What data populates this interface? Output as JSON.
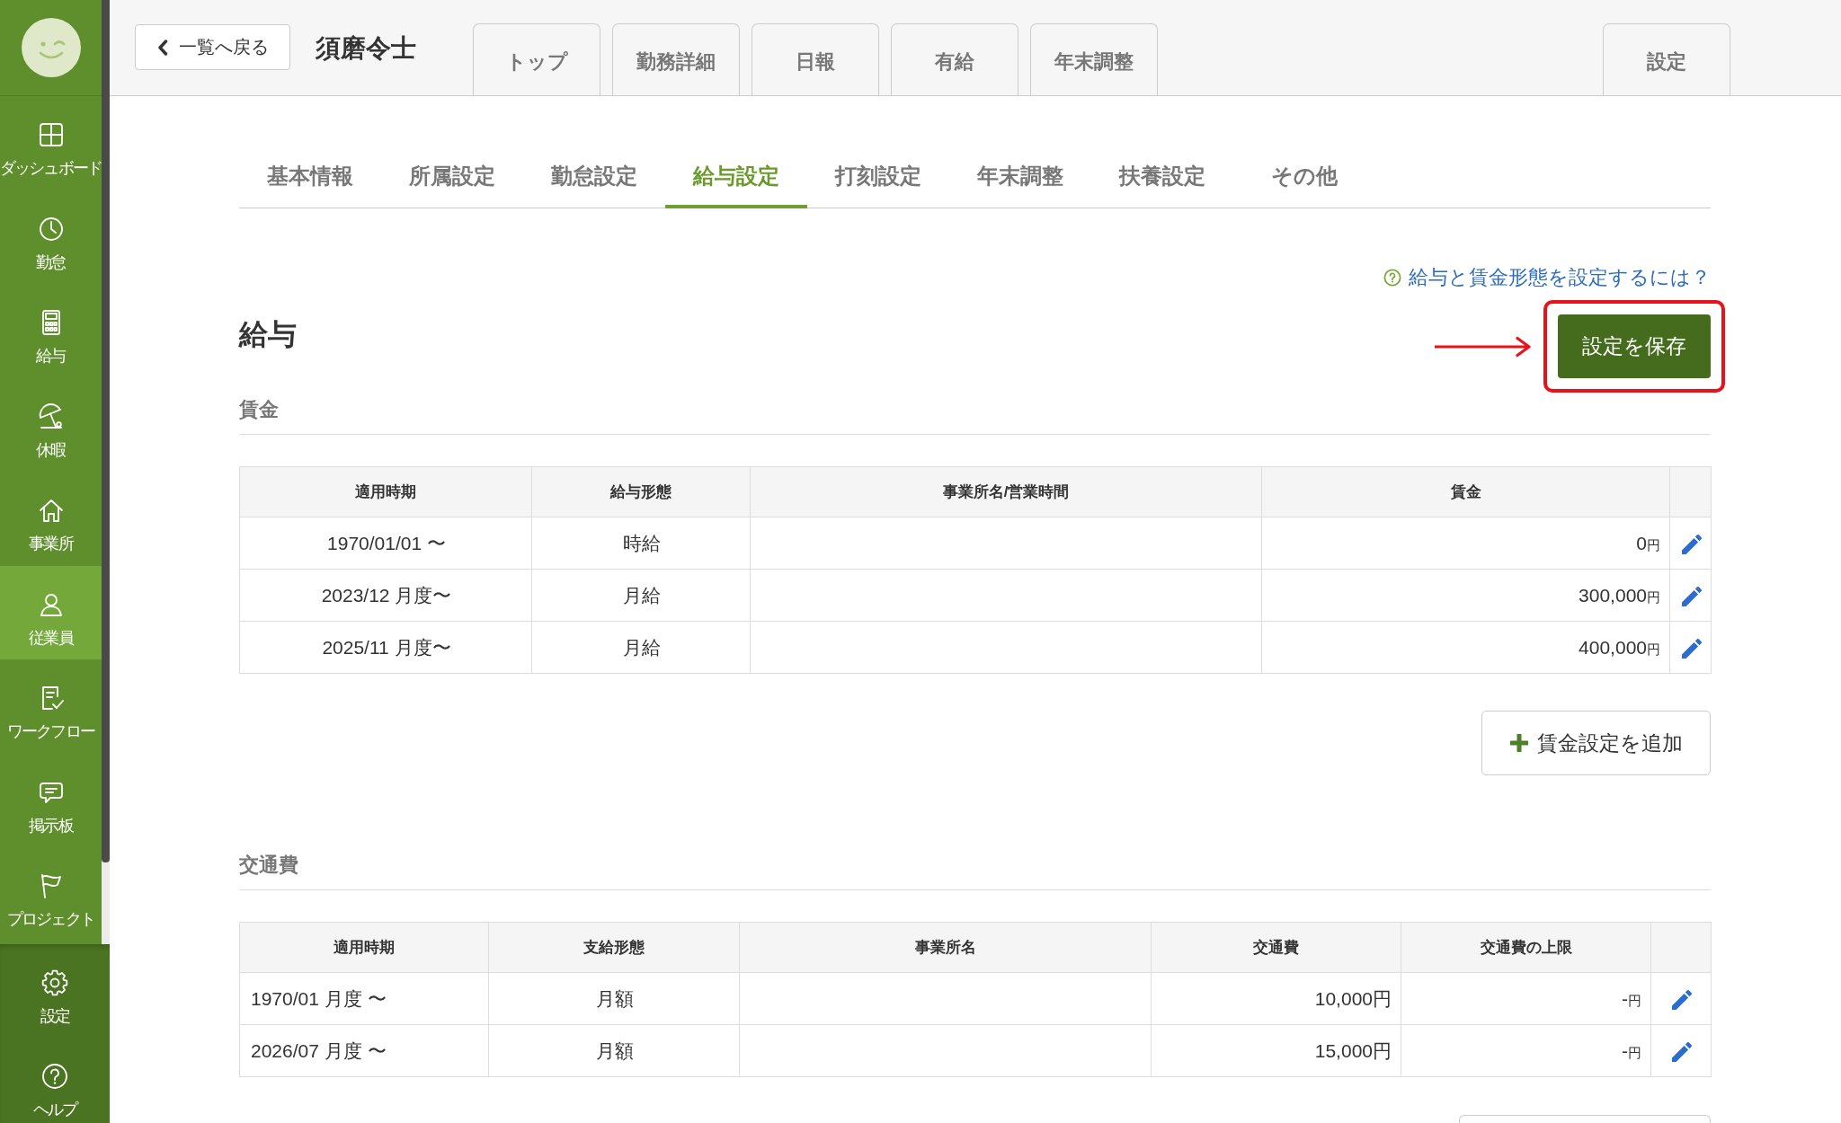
{
  "sidebar": {
    "items": [
      {
        "label": "ダッシュボード",
        "selected": false
      },
      {
        "label": "勤怠",
        "selected": false
      },
      {
        "label": "給与",
        "selected": false
      },
      {
        "label": "休暇",
        "selected": false
      },
      {
        "label": "事業所",
        "selected": false
      },
      {
        "label": "従業員",
        "selected": true
      },
      {
        "label": "ワークフロー",
        "selected": false
      },
      {
        "label": "掲示板",
        "selected": false
      },
      {
        "label": "プロジェクト",
        "selected": false
      }
    ],
    "bottom_items": [
      {
        "label": "設定"
      },
      {
        "label": "ヘルプ"
      }
    ]
  },
  "header": {
    "back_button": "一覧へ戻る",
    "employee_name": "須磨令士",
    "tabs": [
      "トップ",
      "勤務詳細",
      "日報",
      "有給",
      "年末調整"
    ],
    "settings_tab": "設定"
  },
  "subtabs": [
    {
      "label": "基本情報",
      "selected": false
    },
    {
      "label": "所属設定",
      "selected": false
    },
    {
      "label": "勤怠設定",
      "selected": false
    },
    {
      "label": "給与設定",
      "selected": true
    },
    {
      "label": "打刻設定",
      "selected": false
    },
    {
      "label": "年末調整",
      "selected": false
    },
    {
      "label": "扶養設定",
      "selected": false
    },
    {
      "label": "その他",
      "selected": false
    }
  ],
  "help_link": "給与と賃金形態を設定するには？",
  "title": "給与",
  "save_button": {
    "label": "設定を保存",
    "highlighted": true
  },
  "wage": {
    "title": "賃金",
    "columns": [
      "適用時期",
      "給与形態",
      "事業所名/営業時間",
      "賃金"
    ],
    "rows": [
      {
        "period": "1970/01/01 〜",
        "pay_type": "時給",
        "amount": "0",
        "unit": "円"
      },
      {
        "period": "2023/12 月度〜",
        "pay_type": "月給",
        "amount": "300,000",
        "unit": "円"
      },
      {
        "period": "2025/11 月度〜",
        "pay_type": "月給",
        "amount": "400,000",
        "unit": "円"
      }
    ],
    "add_button": "賃金設定を追加"
  },
  "transport": {
    "title": "交通費",
    "columns": [
      "適用時期",
      "支給形態",
      "事業所名",
      "交通費",
      "交通費の上限"
    ],
    "rows": [
      {
        "period": "1970/01 月度 〜",
        "pay_type": "月額",
        "fee": "10,000円",
        "limit": "-",
        "limit_unit": "円"
      },
      {
        "period": "2026/07 月度 〜",
        "pay_type": "月額",
        "fee": "15,000円",
        "limit": "-",
        "limit_unit": "円"
      }
    ],
    "cut_off_button": true
  }
}
